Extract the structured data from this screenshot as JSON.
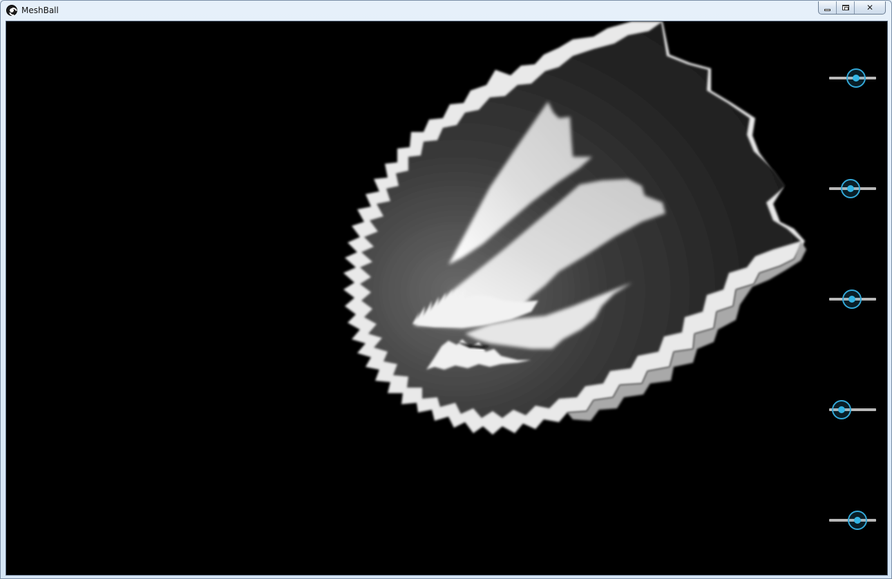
{
  "window": {
    "title": "MeshBall",
    "icon": "meshball-app-icon",
    "controls": {
      "minimize": "minimize-icon",
      "maximize": "maximize-icon",
      "close": "close-icon",
      "close_glyph": "✕"
    }
  },
  "sliders": [
    {
      "name": "slider-1",
      "value": 0.57
    },
    {
      "name": "slider-2",
      "value": 0.45
    },
    {
      "name": "slider-3",
      "value": 0.49
    },
    {
      "name": "slider-4",
      "value": 0.27
    },
    {
      "name": "slider-5",
      "value": 0.61
    }
  ],
  "colors": {
    "accent": "#33b5e5",
    "track": "#b8b8b8",
    "background": "#000000"
  }
}
